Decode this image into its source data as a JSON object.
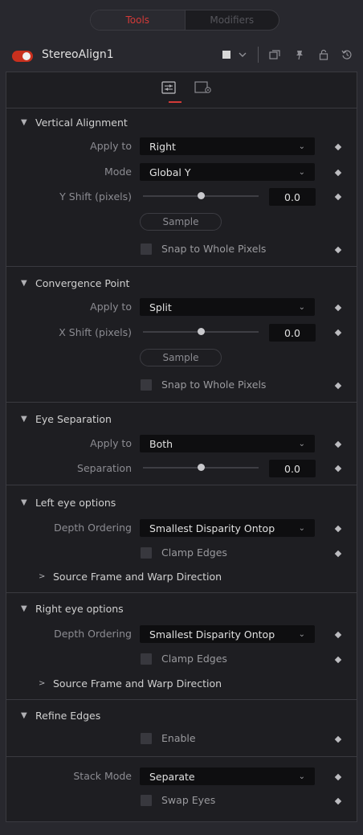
{
  "top_tabs": {
    "tools": "Tools",
    "modifiers": "Modifiers"
  },
  "header": {
    "tool_name": "StereoAlign1",
    "icons": [
      "color-swatch-icon",
      "chevron-down-icon",
      "window-icon",
      "pin-icon",
      "lock-icon",
      "reset-icon"
    ]
  },
  "subtabs": [
    "controls-icon",
    "settings-icon"
  ],
  "vertical_alignment": {
    "title": "Vertical Alignment",
    "apply_to_label": "Apply to",
    "apply_to_value": "Right",
    "mode_label": "Mode",
    "mode_value": "Global Y",
    "yshift_label": "Y Shift (pixels)",
    "yshift_value": "0.0",
    "yshift_slider": 0.5,
    "sample_label": "Sample",
    "snap_label": "Snap to Whole Pixels"
  },
  "convergence_point": {
    "title": "Convergence Point",
    "apply_to_label": "Apply to",
    "apply_to_value": "Split",
    "xshift_label": "X Shift (pixels)",
    "xshift_value": "0.0",
    "xshift_slider": 0.5,
    "sample_label": "Sample",
    "snap_label": "Snap to Whole Pixels"
  },
  "eye_separation": {
    "title": "Eye Separation",
    "apply_to_label": "Apply to",
    "apply_to_value": "Both",
    "separation_label": "Separation",
    "separation_value": "0.0",
    "separation_slider": 0.5
  },
  "left_eye": {
    "title": "Left eye options",
    "depth_label": "Depth Ordering",
    "depth_value": "Smallest Disparity Ontop",
    "clamp_label": "Clamp Edges",
    "source_frame_label": "Source Frame and Warp Direction"
  },
  "right_eye": {
    "title": "Right eye options",
    "depth_label": "Depth Ordering",
    "depth_value": "Smallest Disparity Ontop",
    "clamp_label": "Clamp Edges",
    "source_frame_label": "Source Frame and Warp Direction"
  },
  "refine_edges": {
    "title": "Refine Edges",
    "enable_label": "Enable"
  },
  "stack": {
    "stack_mode_label": "Stack Mode",
    "stack_mode_value": "Separate",
    "swap_label": "Swap Eyes"
  },
  "colors": {
    "accent": "#d33a38",
    "toggle": "#c8301e"
  }
}
